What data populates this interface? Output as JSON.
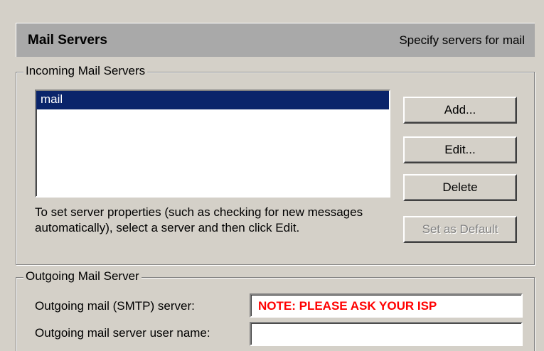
{
  "header": {
    "title": "Mail Servers",
    "subtitle": "Specify servers for mail"
  },
  "incoming": {
    "group_label": "Incoming Mail Servers",
    "servers": [
      "mail"
    ],
    "selected_index": 0,
    "help_text": "To set server properties (such as checking for new messages automatically), select a server and then click Edit.",
    "buttons": {
      "add": "Add...",
      "edit": "Edit...",
      "delete": "Delete",
      "set_default": "Set as Default"
    }
  },
  "outgoing": {
    "group_label": "Outgoing Mail Server",
    "smtp_label": "Outgoing mail (SMTP) server:",
    "smtp_value": "NOTE: PLEASE ASK YOUR ISP",
    "username_label": "Outgoing mail server user name:",
    "username_value": ""
  },
  "colors": {
    "selection": "#0a246a",
    "note_text": "#ff0000",
    "header_bg": "#a9a9a9",
    "window_bg": "#d4d0c8"
  }
}
